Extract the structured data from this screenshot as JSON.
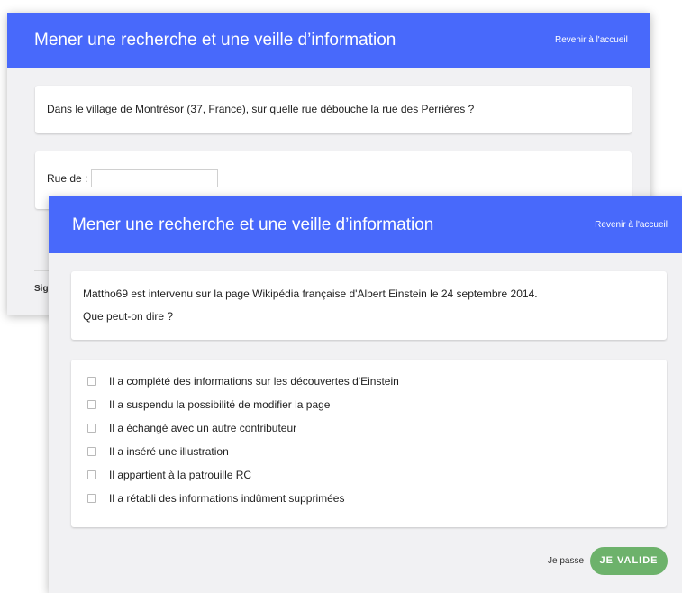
{
  "back_window": {
    "title": "Mener une recherche et une veille d’information",
    "home_link": "Revenir à l'accueil",
    "question": "Dans le village de Montrésor (37, France), sur quelle rue débouche la rue des Perrières ?",
    "answer_label": "Rue de :",
    "answer_value": "",
    "footer_fragment": "Sig"
  },
  "front_window": {
    "title": "Mener une recherche et une veille d’information",
    "home_link": "Revenir à l'accueil",
    "question_line1": "Mattho69 est intervenu sur la page Wikipédia française d'Albert Einstein le 24 septembre 2014.",
    "question_line2": "Que peut-on dire ?",
    "options": [
      {
        "label": "Il a complété des informations sur les découvertes d'Einstein",
        "checked": false
      },
      {
        "label": "Il a suspendu la possibilité de modifier la page",
        "checked": false
      },
      {
        "label": "Il a échangé avec un autre contributeur",
        "checked": false
      },
      {
        "label": "Il a inséré une illustration",
        "checked": false
      },
      {
        "label": "Il appartient à la patrouille RC",
        "checked": false
      },
      {
        "label": "Il a rétabli des informations indûment supprimées",
        "checked": false
      }
    ],
    "skip_label": "Je passe",
    "validate_label": "JE VALIDE"
  },
  "colors": {
    "header": "#4869fb",
    "validate": "#6db26b",
    "background": "#f1f1f3"
  }
}
